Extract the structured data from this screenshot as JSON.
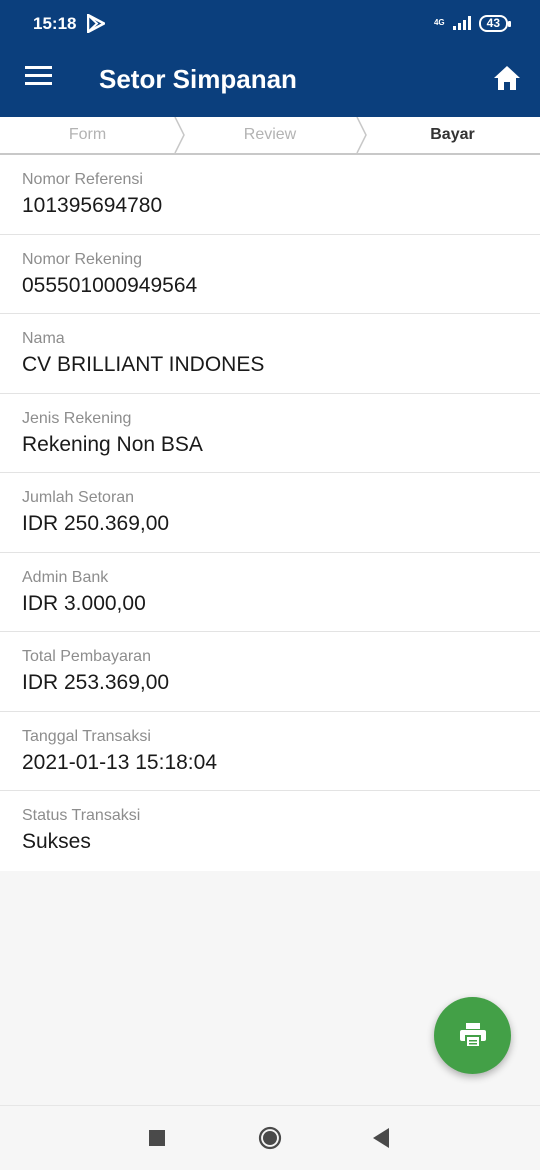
{
  "status_bar": {
    "time": "15:18",
    "network": "4G",
    "battery": "43"
  },
  "app_bar": {
    "title": "Setor Simpanan",
    "menu_icon": "hamburger-menu-icon",
    "home_icon": "home-icon"
  },
  "steps": [
    {
      "label": "Form",
      "active": false
    },
    {
      "label": "Review",
      "active": false
    },
    {
      "label": "Bayar",
      "active": true
    }
  ],
  "details": [
    {
      "label": "Nomor Referensi",
      "value": "101395694780"
    },
    {
      "label": "Nomor Rekening",
      "value": "055501000949564"
    },
    {
      "label": "Nama",
      "value": "CV BRILLIANT INDONES"
    },
    {
      "label": "Jenis Rekening",
      "value": "Rekening Non BSA"
    },
    {
      "label": "Jumlah Setoran",
      "value": "IDR 250.369,00"
    },
    {
      "label": "Admin Bank",
      "value": "IDR 3.000,00"
    },
    {
      "label": "Total Pembayaran",
      "value": "IDR 253.369,00"
    },
    {
      "label": "Tanggal Transaksi",
      "value": "2021-01-13 15:18:04"
    },
    {
      "label": "Status Transaksi",
      "value": "Sukses"
    }
  ],
  "fab": {
    "icon": "printer-icon",
    "color": "#43a047"
  },
  "colors": {
    "primary": "#0b3f7d",
    "accent": "#43a047"
  },
  "nav_bar": {
    "icons": [
      "recents-square-icon",
      "home-circle-icon",
      "back-triangle-icon"
    ]
  }
}
